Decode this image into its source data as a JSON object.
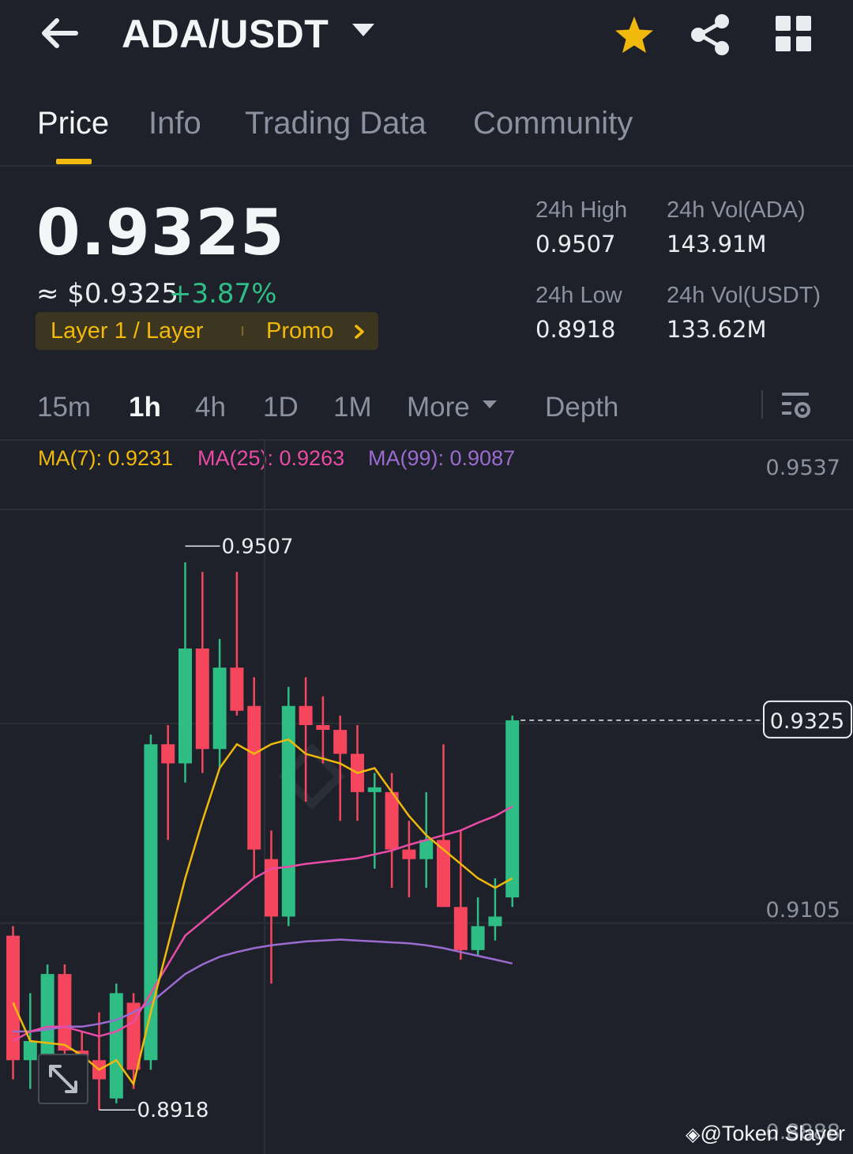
{
  "header": {
    "pair": "ADA/USDT",
    "icons": [
      "back-arrow-icon",
      "caret-down-icon",
      "star-icon",
      "share-icon",
      "grid-icon"
    ],
    "favorite_color": "#f0b90b"
  },
  "tabs": [
    "Price",
    "Info",
    "Trading Data",
    "Community"
  ],
  "active_tab": "Price",
  "price": {
    "last": "0.9325",
    "usd": "≈ $0.9325",
    "change": "+3.87%",
    "change_color": "#2ebd85"
  },
  "tag": {
    "category": "Layer 1 / Layer",
    "promo": "Promo"
  },
  "stats": {
    "high_label": "24h High",
    "high_value": "0.9507",
    "low_label": "24h Low",
    "low_value": "0.8918",
    "vol_ada_label": "24h Vol(ADA)",
    "vol_ada_value": "143.91M",
    "vol_usdt_label": "24h Vol(USDT)",
    "vol_usdt_value": "133.62M"
  },
  "intervals": [
    "15m",
    "1h",
    "4h",
    "1D",
    "1M",
    "More",
    "Depth"
  ],
  "active_interval": "1h",
  "ma": {
    "ma7": "MA(7): 0.9231",
    "ma25": "MA(25): 0.9263",
    "ma99": "MA(99): 0.9087",
    "colors": {
      "ma7": "#f0b90b",
      "ma25": "#e94ba6",
      "ma99": "#9c6bd1"
    }
  },
  "chart_data": {
    "type": "candlestick",
    "y_ticks": [
      "0.9537",
      "0.9105",
      "0.8888"
    ],
    "ylim": [
      0.8872,
      0.9617
    ],
    "last_price_label": "0.9325",
    "max_label": "0.9507",
    "min_label": "0.8918",
    "up_color": "#2ebd85",
    "down_color": "#f6465d",
    "candles": [
      {
        "o": 0.91,
        "h": 0.911,
        "l": 0.895,
        "c": 0.897
      },
      {
        "o": 0.897,
        "h": 0.904,
        "l": 0.894,
        "c": 0.899
      },
      {
        "o": 0.895,
        "h": 0.907,
        "l": 0.894,
        "c": 0.906
      },
      {
        "o": 0.906,
        "h": 0.907,
        "l": 0.895,
        "c": 0.898
      },
      {
        "o": 0.898,
        "h": 0.9,
        "l": 0.895,
        "c": 0.897
      },
      {
        "o": 0.897,
        "h": 0.902,
        "l": 0.8918,
        "c": 0.895
      },
      {
        "o": 0.893,
        "h": 0.905,
        "l": 0.8925,
        "c": 0.904
      },
      {
        "o": 0.903,
        "h": 0.904,
        "l": 0.894,
        "c": 0.896
      },
      {
        "o": 0.897,
        "h": 0.931,
        "l": 0.896,
        "c": 0.93
      },
      {
        "o": 0.93,
        "h": 0.932,
        "l": 0.92,
        "c": 0.928
      },
      {
        "o": 0.928,
        "h": 0.949,
        "l": 0.926,
        "c": 0.94
      },
      {
        "o": 0.94,
        "h": 0.948,
        "l": 0.927,
        "c": 0.9295
      },
      {
        "o": 0.9295,
        "h": 0.941,
        "l": 0.9275,
        "c": 0.938
      },
      {
        "o": 0.938,
        "h": 0.948,
        "l": 0.933,
        "c": 0.9335
      },
      {
        "o": 0.934,
        "h": 0.937,
        "l": 0.916,
        "c": 0.919
      },
      {
        "o": 0.918,
        "h": 0.921,
        "l": 0.905,
        "c": 0.912
      },
      {
        "o": 0.912,
        "h": 0.936,
        "l": 0.911,
        "c": 0.934
      },
      {
        "o": 0.934,
        "h": 0.937,
        "l": 0.924,
        "c": 0.932
      },
      {
        "o": 0.932,
        "h": 0.935,
        "l": 0.928,
        "c": 0.9315
      },
      {
        "o": 0.9315,
        "h": 0.933,
        "l": 0.922,
        "c": 0.929
      },
      {
        "o": 0.929,
        "h": 0.932,
        "l": 0.922,
        "c": 0.925
      },
      {
        "o": 0.925,
        "h": 0.927,
        "l": 0.917,
        "c": 0.9255
      },
      {
        "o": 0.925,
        "h": 0.927,
        "l": 0.915,
        "c": 0.919
      },
      {
        "o": 0.919,
        "h": 0.922,
        "l": 0.914,
        "c": 0.918
      },
      {
        "o": 0.918,
        "h": 0.925,
        "l": 0.915,
        "c": 0.92
      },
      {
        "o": 0.92,
        "h": 0.93,
        "l": 0.915,
        "c": 0.913
      },
      {
        "o": 0.913,
        "h": 0.921,
        "l": 0.9075,
        "c": 0.9085
      },
      {
        "o": 0.9085,
        "h": 0.914,
        "l": 0.908,
        "c": 0.911
      },
      {
        "o": 0.911,
        "h": 0.916,
        "l": 0.9095,
        "c": 0.912
      },
      {
        "o": 0.914,
        "h": 0.933,
        "l": 0.913,
        "c": 0.9325
      }
    ],
    "ma7_values": [
      0.903,
      0.899,
      0.8988,
      0.8986,
      0.8975,
      0.896,
      0.897,
      0.8945,
      0.902,
      0.909,
      0.916,
      0.922,
      0.9275,
      0.93,
      0.929,
      0.93,
      0.9305,
      0.929,
      0.9285,
      0.928,
      0.927,
      0.9275,
      0.925,
      0.9225,
      0.9205,
      0.919,
      0.9175,
      0.916,
      0.915,
      0.916
    ],
    "ma25_values": [
      0.899,
      0.9,
      0.9005,
      0.9005,
      0.9,
      0.8995,
      0.9,
      0.901,
      0.904,
      0.907,
      0.91,
      0.9115,
      0.913,
      0.9145,
      0.916,
      0.917,
      0.9172,
      0.9175,
      0.9177,
      0.9179,
      0.9181,
      0.9185,
      0.9189,
      0.9195,
      0.92,
      0.9205,
      0.921,
      0.9218,
      0.9225,
      0.9235
    ],
    "ma99_values": [
      0.9,
      0.9,
      0.9002,
      0.9005,
      0.9005,
      0.9008,
      0.9012,
      0.902,
      0.903,
      0.9045,
      0.906,
      0.907,
      0.9078,
      0.9083,
      0.9087,
      0.909,
      0.9092,
      0.9094,
      0.9095,
      0.9096,
      0.9095,
      0.9094,
      0.9093,
      0.9092,
      0.909,
      0.9087,
      0.9083,
      0.9079,
      0.9075,
      0.9071
    ]
  },
  "watermark": "@Token Slayer"
}
